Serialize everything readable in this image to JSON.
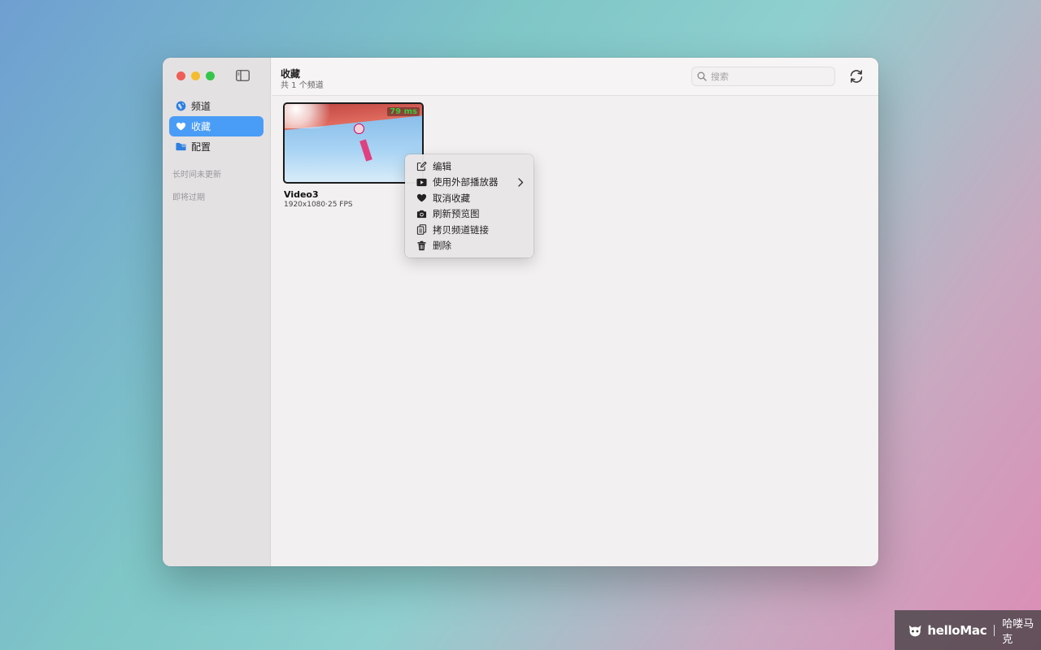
{
  "sidebar": {
    "items": [
      {
        "label": "频道",
        "icon": "globe-icon"
      },
      {
        "label": "收藏",
        "icon": "heart-icon",
        "active": true
      },
      {
        "label": "配置",
        "icon": "folder-settings-icon"
      }
    ],
    "sections": [
      "长时间未更新",
      "即将过期"
    ]
  },
  "header": {
    "title": "收藏",
    "subtitle": "共 1 个频道"
  },
  "search": {
    "placeholder": "搜索",
    "value": ""
  },
  "channel": {
    "name": "Video3",
    "meta": "1920x1080·25 FPS",
    "latency": "79 ms"
  },
  "context_menu": {
    "items": [
      {
        "label": "编辑",
        "icon": "edit-icon"
      },
      {
        "label": "使用外部播放器",
        "icon": "play-icon",
        "submenu": true
      },
      {
        "label": "取消收藏",
        "icon": "heart-filled-icon"
      },
      {
        "label": "刷新预览图",
        "icon": "camera-icon"
      },
      {
        "label": "拷贝频道链接",
        "icon": "copy-icon"
      },
      {
        "label": "删除",
        "icon": "trash-icon"
      }
    ]
  },
  "watermark": {
    "brand": "helloMac",
    "cn": "哈喽马克"
  },
  "colors": {
    "accent": "#4a9df6",
    "latency": "#3ccb3c",
    "close": "#ee5e57",
    "minimize": "#f4bd2f",
    "zoom": "#35c649"
  }
}
